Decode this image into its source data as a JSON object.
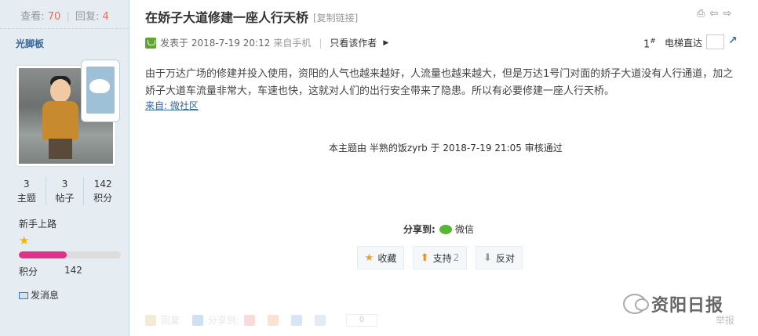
{
  "sidebar": {
    "views_label": "查看:",
    "views_value": "70",
    "replies_label": "回复:",
    "replies_value": "4",
    "username": "光脚板",
    "counters": [
      {
        "value": "3",
        "label": "主题"
      },
      {
        "value": "3",
        "label": "帖子"
      },
      {
        "value": "142",
        "label": "积分"
      }
    ],
    "level": "新手上路",
    "progress_fraction": 0.47,
    "score_label": "积分",
    "score_value": "142",
    "message_label": "发消息"
  },
  "post": {
    "title": "在娇子大道修建一座人行天桥",
    "copy_link": "[复制链接]",
    "posted_prefix": "发表于",
    "posted_time": "2018-7-19 20:12",
    "from_mobile": "来自手机",
    "only_author": "只看该作者",
    "floor": "1",
    "floor_suffix": "#",
    "jump_label": "电梯直达",
    "body": "由于万达广场的修建并投入使用，资阳的人气也越来越好，人流量也越来越大，但是万达1号门对面的娇子大道没有人行通道，加之娇子大道车流量非常大，车速也快，这就对人们的出行安全带来了隐患。所以有必要修建一座人行天桥。",
    "source": "来自: 微社区",
    "review": "本主题由 半熟的饭zyrb 于 2018-7-19 21:05 审核通过"
  },
  "share": {
    "label": "分享到:",
    "wechat": "微信"
  },
  "actions": {
    "favorite": "收藏",
    "support": "支持",
    "support_count": "2",
    "oppose": "反对"
  },
  "footer": {
    "reply": "回复",
    "share": "分享到:",
    "count": "0",
    "report": "举报"
  },
  "watermark": {
    "text": "资阳日报"
  },
  "colors": {
    "sidebar_bg": "#E5EDF2",
    "accent_number": "#F26C4F",
    "progress": "#E0318B",
    "link": "#336699"
  }
}
